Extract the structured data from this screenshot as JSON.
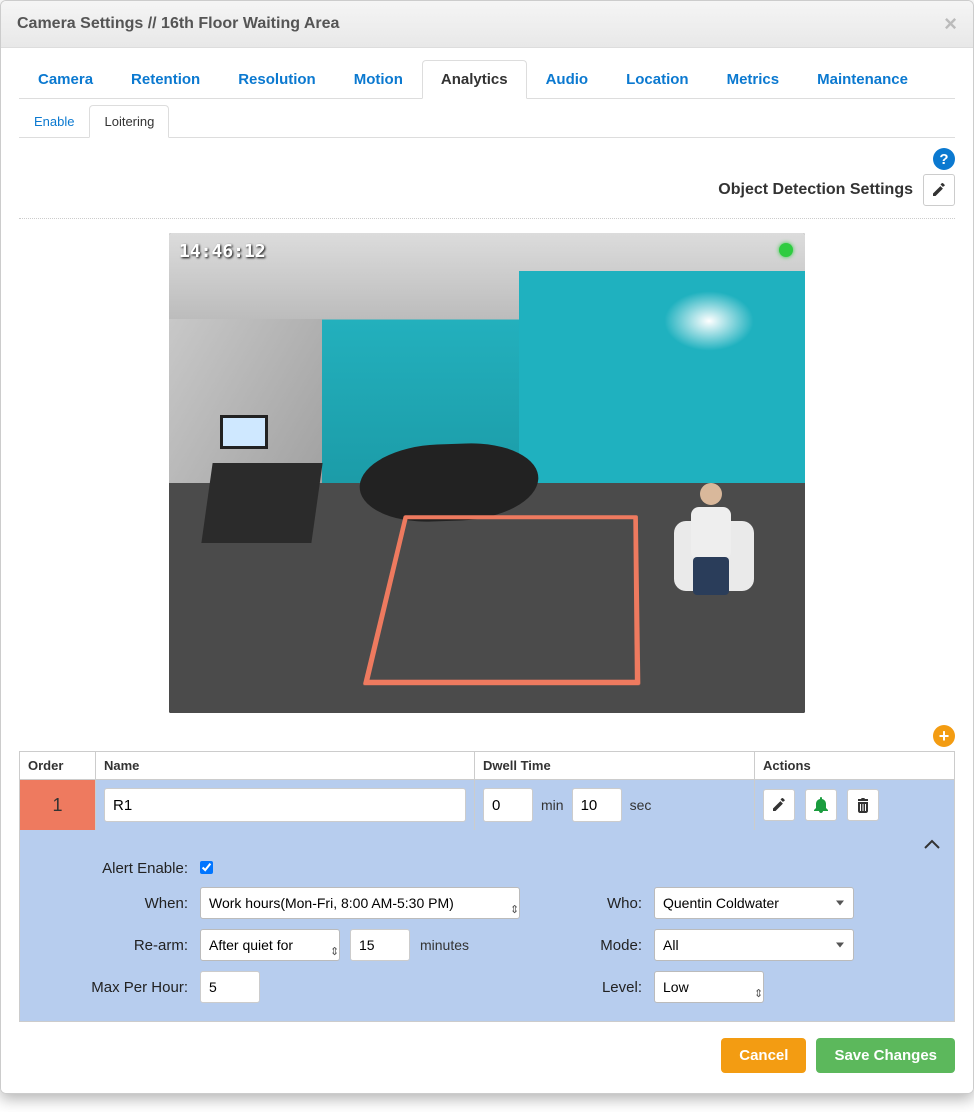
{
  "header": {
    "title": "Camera Settings // 16th Floor Waiting Area"
  },
  "tabs_top": {
    "items": [
      "Camera",
      "Retention",
      "Resolution",
      "Motion",
      "Analytics",
      "Audio",
      "Location",
      "Metrics",
      "Maintenance"
    ],
    "active": "Analytics"
  },
  "tabs_sub": {
    "items": [
      "Enable",
      "Loitering"
    ],
    "active": "Loitering"
  },
  "ods": {
    "label": "Object Detection Settings"
  },
  "preview": {
    "timestamp": "14:46:12"
  },
  "table": {
    "headers": {
      "order": "Order",
      "name": "Name",
      "dwell": "Dwell Time",
      "actions": "Actions"
    },
    "row": {
      "order": "1",
      "name": "R1",
      "dwell_min": "0",
      "dwell_sec": "10",
      "unit_min": "min",
      "unit_sec": "sec"
    }
  },
  "form": {
    "alert_enable_label": "Alert Enable:",
    "alert_enable": true,
    "when_label": "When:",
    "when_value": "Work hours(Mon-Fri, 8:00 AM-5:30 PM)",
    "who_label": "Who:",
    "who_value": "Quentin Coldwater",
    "rearm_label": "Re-arm:",
    "rearm_mode": "After quiet for",
    "rearm_minutes": "15",
    "rearm_unit": "minutes",
    "mode_label": "Mode:",
    "mode_value": "All",
    "max_label": "Max Per Hour:",
    "max_value": "5",
    "level_label": "Level:",
    "level_value": "Low"
  },
  "footer": {
    "cancel": "Cancel",
    "save": "Save Changes"
  }
}
